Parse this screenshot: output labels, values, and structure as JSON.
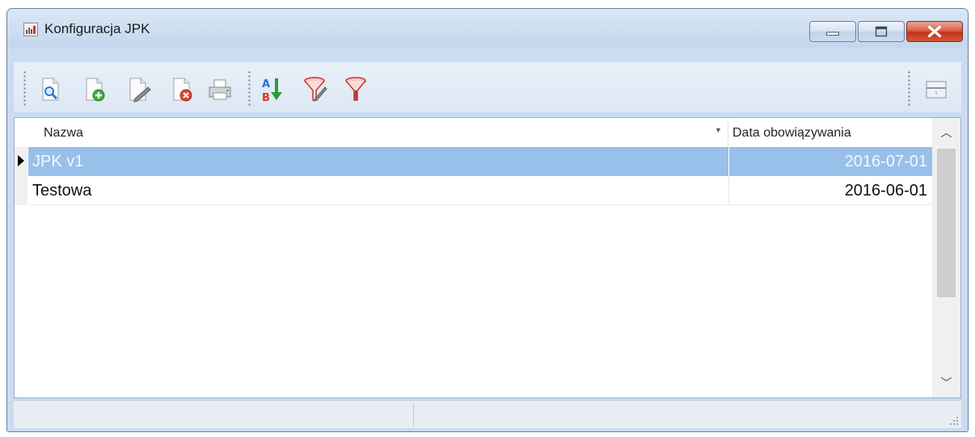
{
  "window": {
    "title": "Konfiguracja JPK",
    "icon": "app-chart-icon"
  },
  "toolbar": {
    "buttons": [
      {
        "name": "preview-icon"
      },
      {
        "name": "add-document-icon"
      },
      {
        "name": "edit-document-icon"
      },
      {
        "name": "delete-document-icon"
      },
      {
        "name": "print-icon"
      },
      {
        "name": "sort-ab-icon"
      },
      {
        "name": "filter-edit-icon"
      },
      {
        "name": "filter-icon"
      },
      {
        "name": "layout-options-icon"
      }
    ]
  },
  "grid": {
    "columns": [
      "Nazwa",
      "Data obowiązywania"
    ],
    "rows": [
      {
        "name": "JPK v1",
        "date": "2016-07-01",
        "selected": true
      },
      {
        "name": "Testowa",
        "date": "2016-06-01",
        "selected": false
      }
    ]
  },
  "colors": {
    "selection": "#99c0ea",
    "window_frame": "#c9dcf0",
    "close_button": "#c2351a"
  }
}
